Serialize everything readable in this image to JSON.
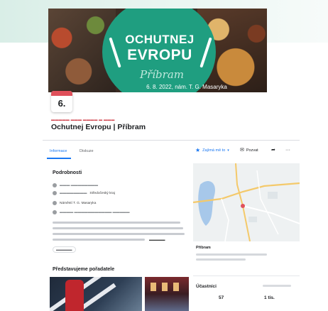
{
  "cover": {
    "title_line1": "OCHUTNEJ",
    "title_line2": "EVROPU",
    "script_text": "Příbram",
    "date_text": "6. 8. 2022, nám. T. G. Masaryka"
  },
  "event": {
    "date_day": "6.",
    "title": "Ochutnej Evropu | Příbram"
  },
  "tabs": [
    {
      "label": "Informace"
    },
    {
      "label": "Diskuze"
    }
  ],
  "actions": {
    "interested": "Zajímá mě to",
    "invite": "Pozvat",
    "share_icon": "share-icon",
    "more_icon": "more-icon"
  },
  "details": {
    "heading": "Podrobnosti",
    "organizer_strong": "Středočeský kraj",
    "location": "Náměstí T. G. Masaryka"
  },
  "map": {
    "caption": "Příbram"
  },
  "hosts": {
    "heading": "Představujeme pořadatele"
  },
  "participants": {
    "heading": "Účastníci",
    "going": "57",
    "interested": "1 tis."
  },
  "colors": {
    "accent": "#1877f2",
    "cover_green": "#1f9e80",
    "date_red": "#e0505a"
  }
}
